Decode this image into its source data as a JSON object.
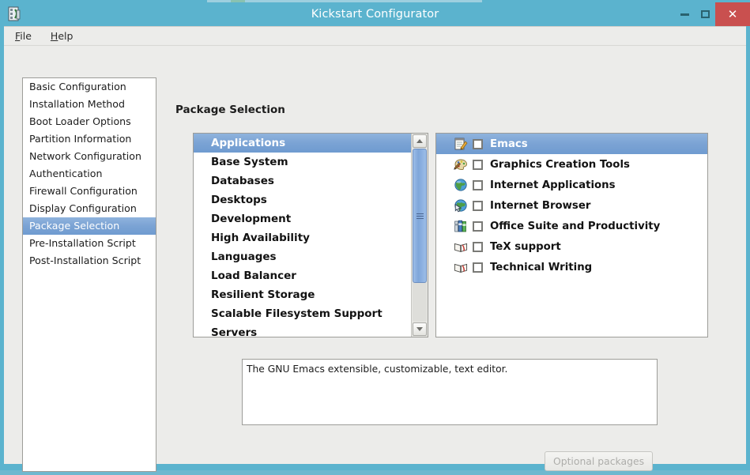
{
  "window": {
    "title": "Kickstart Configurator",
    "icon": "app-icon",
    "controls": {
      "minimize": "–",
      "maximize": "□",
      "close": "✕"
    },
    "titlebar_color": "#5bb3ce",
    "close_color": "#c9504f"
  },
  "menubar": {
    "items": [
      {
        "label": "File",
        "mnemonic": "F"
      },
      {
        "label": "Help",
        "mnemonic": "H"
      }
    ]
  },
  "sidebar": {
    "items": [
      {
        "label": "Basic Configuration",
        "selected": false
      },
      {
        "label": "Installation Method",
        "selected": false
      },
      {
        "label": "Boot Loader Options",
        "selected": false
      },
      {
        "label": "Partition Information",
        "selected": false
      },
      {
        "label": "Network Configuration",
        "selected": false
      },
      {
        "label": "Authentication",
        "selected": false
      },
      {
        "label": "Firewall Configuration",
        "selected": false
      },
      {
        "label": "Display Configuration",
        "selected": false
      },
      {
        "label": "Package Selection",
        "selected": true
      },
      {
        "label": "Pre-Installation Script",
        "selected": false
      },
      {
        "label": "Post-Installation Script",
        "selected": false
      }
    ]
  },
  "main": {
    "page_title": "Package Selection",
    "group_list": {
      "items": [
        {
          "label": "Applications",
          "selected": true
        },
        {
          "label": "Base System",
          "selected": false
        },
        {
          "label": "Databases",
          "selected": false
        },
        {
          "label": "Desktops",
          "selected": false
        },
        {
          "label": "Development",
          "selected": false
        },
        {
          "label": "High Availability",
          "selected": false
        },
        {
          "label": "Languages",
          "selected": false
        },
        {
          "label": "Load Balancer",
          "selected": false
        },
        {
          "label": "Resilient Storage",
          "selected": false
        },
        {
          "label": "Scalable Filesystem Support",
          "selected": false
        },
        {
          "label": "Servers",
          "selected": false
        }
      ],
      "scrollbar": {
        "up_arrow": "scroll-up-arrow",
        "down_arrow": "scroll-down-arrow",
        "thumb_position_percent": 0
      }
    },
    "package_list": {
      "items": [
        {
          "label": "Emacs",
          "icon": "notepad-pencil-icon",
          "checked": false,
          "selected": true
        },
        {
          "label": "Graphics Creation Tools",
          "icon": "palette-icon",
          "checked": false,
          "selected": false
        },
        {
          "label": "Internet Applications",
          "icon": "globe-icon",
          "checked": false,
          "selected": false
        },
        {
          "label": "Internet Browser",
          "icon": "globe-cursor-icon",
          "checked": false,
          "selected": false
        },
        {
          "label": "Office Suite and Productivity",
          "icon": "binders-icon",
          "checked": false,
          "selected": false
        },
        {
          "label": "TeX support",
          "icon": "open-book-icon",
          "checked": false,
          "selected": false
        },
        {
          "label": "Technical Writing",
          "icon": "open-book-icon",
          "checked": false,
          "selected": false
        }
      ]
    },
    "description": "The GNU Emacs extensible, customizable, text editor.",
    "optional_packages_button": {
      "label": "Optional packages",
      "enabled": false
    }
  }
}
